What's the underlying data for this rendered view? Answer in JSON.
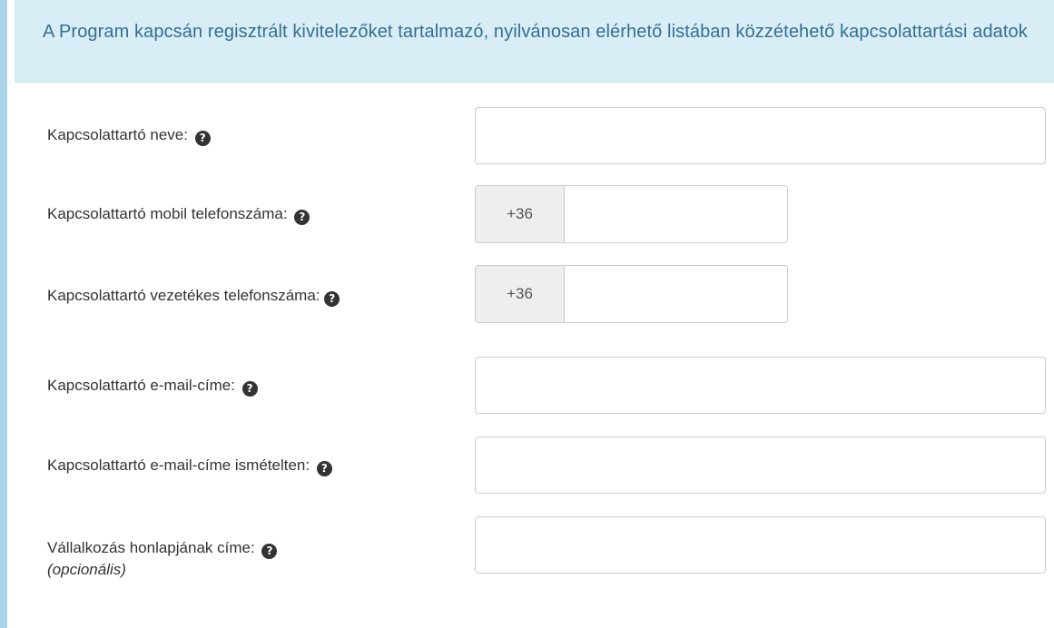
{
  "section": {
    "title": "A Program kapcsán regisztrált kivitelezőket tartalmazó, nyilvánosan elérhető listában közzétehető kapcsolattartási adatok"
  },
  "form": {
    "contact_name": {
      "label": "Kapcsolattartó neve:",
      "value": ""
    },
    "mobile_phone": {
      "label": "Kapcsolattartó mobil telefonszáma:",
      "prefix": "+36",
      "value": ""
    },
    "landline_phone": {
      "label": "Kapcsolattartó vezetékes telefonszáma:",
      "prefix": "+36",
      "value": ""
    },
    "email": {
      "label": "Kapcsolattartó e-mail-címe:",
      "value": ""
    },
    "email_repeat": {
      "label": "Kapcsolattartó e-mail-címe ismételten:",
      "value": ""
    },
    "website": {
      "label": "Vállalkozás honlapjának címe:",
      "optional_note": "(opcionális)",
      "value": ""
    }
  },
  "icons": {
    "help": "question-circle-icon",
    "help_glyph": "?"
  },
  "colors": {
    "header_bg": "#d9edf7",
    "header_text": "#31708f",
    "accent_border": "#a9d4ea",
    "prefix_bg": "#eeeeee"
  }
}
